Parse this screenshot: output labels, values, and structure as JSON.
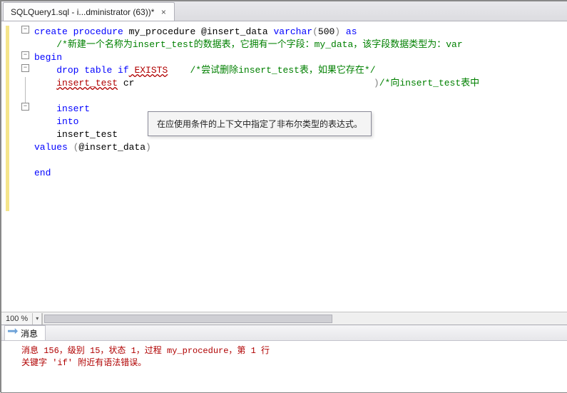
{
  "tab": {
    "title": "SQLQuery1.sql - i...dministrator (63))*",
    "close": "×"
  },
  "code": {
    "l1_a": "create",
    "l1_b": " procedure",
    "l1_c": " my_procedure ",
    "l1_d": "@insert_data ",
    "l1_e": "varchar",
    "l1_op1": "(",
    "l1_num": "500",
    "l1_op2": ") ",
    "l1_f": "as",
    "l2_a": "    ",
    "l2_cmt": "/*新建一个名称为insert_test的数据表，它拥有一个字段：my_data，该字段数据类型为：var",
    "l3_a": "begin",
    "l4_a": "    ",
    "l4_b": "drop",
    "l4_c": " table",
    "l4_d": " if",
    "l4_err": " EXISTS",
    "l4_sp": "    ",
    "l4_cmt": "/*尝试删除insert_test表，如果它存在*/",
    "l5_a": "    ",
    "l5_err": "insert_test",
    "l5_b": " cr",
    "l5_sp": "                                           ",
    "l5_op": ")",
    "l5_cmt": "/*向insert_test表中",
    "l6": "",
    "l7_a": "    ",
    "l7_b": "insert",
    "l8_a": "    ",
    "l8_b": "into",
    "l9_a": "    insert_test",
    "l10_a": "values",
    "l10_op1": " (",
    "l10_b": "@insert_data",
    "l10_op2": ")",
    "l11": "",
    "l12_a": "end"
  },
  "tooltip": "在应使用条件的上下文中指定了非布尔类型的表达式。",
  "zoom": "100 %",
  "messages": {
    "tab_label": "消息",
    "line1": "消息 156，级别 15，状态 1，过程 my_procedure，第 1 行",
    "line2": "关键字 'if' 附近有语法错误。"
  }
}
